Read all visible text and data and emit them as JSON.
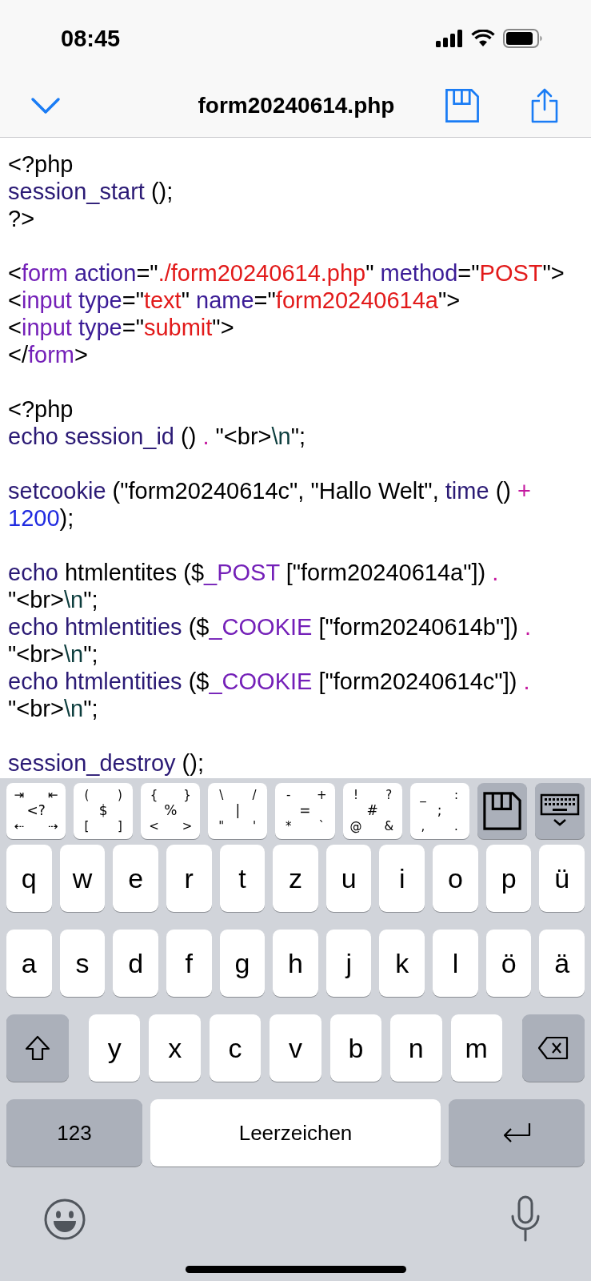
{
  "status_bar": {
    "time": "08:45"
  },
  "nav_bar": {
    "title": "form20240614.php"
  },
  "code_lines": [
    {
      "kind": "code",
      "tokens": [
        {
          "kind": "plain",
          "text": "<?php"
        }
      ]
    },
    {
      "kind": "code",
      "tokens": [
        {
          "kind": "func",
          "text": "session_start"
        },
        {
          "kind": "plain",
          "text": " ();"
        }
      ]
    },
    {
      "kind": "code",
      "tokens": [
        {
          "kind": "plain",
          "text": "?>"
        }
      ]
    },
    {
      "kind": "blank"
    },
    {
      "kind": "code",
      "tokens": [
        {
          "kind": "plain",
          "text": "<"
        },
        {
          "kind": "tag",
          "text": "form"
        },
        {
          "kind": "attr",
          "text": " action"
        },
        {
          "kind": "plain",
          "text": "=\""
        },
        {
          "kind": "string",
          "text": "./form20240614.php"
        },
        {
          "kind": "plain",
          "text": "\" "
        },
        {
          "kind": "attr",
          "text": "method"
        },
        {
          "kind": "plain",
          "text": "=\""
        },
        {
          "kind": "string",
          "text": "POST"
        },
        {
          "kind": "plain",
          "text": "\">"
        }
      ]
    },
    {
      "kind": "code",
      "tokens": [
        {
          "kind": "plain",
          "text": "<"
        },
        {
          "kind": "tag",
          "text": "input"
        },
        {
          "kind": "attr",
          "text": " type"
        },
        {
          "kind": "plain",
          "text": "=\""
        },
        {
          "kind": "string",
          "text": "text"
        },
        {
          "kind": "plain",
          "text": "\" "
        },
        {
          "kind": "attr",
          "text": "name"
        },
        {
          "kind": "plain",
          "text": "=\""
        },
        {
          "kind": "string",
          "text": "form20240614a"
        },
        {
          "kind": "plain",
          "text": "\">"
        }
      ]
    },
    {
      "kind": "code",
      "tokens": [
        {
          "kind": "plain",
          "text": "<"
        },
        {
          "kind": "tag",
          "text": "input"
        },
        {
          "kind": "attr",
          "text": " type"
        },
        {
          "kind": "plain",
          "text": "=\""
        },
        {
          "kind": "string",
          "text": "submit"
        },
        {
          "kind": "plain",
          "text": "\">"
        }
      ]
    },
    {
      "kind": "code",
      "tokens": [
        {
          "kind": "plain",
          "text": "</"
        },
        {
          "kind": "tag",
          "text": "form"
        },
        {
          "kind": "plain",
          "text": ">"
        }
      ]
    },
    {
      "kind": "blank"
    },
    {
      "kind": "code",
      "tokens": [
        {
          "kind": "plain",
          "text": "<?php"
        }
      ]
    },
    {
      "kind": "code",
      "tokens": [
        {
          "kind": "func",
          "text": "echo session_id"
        },
        {
          "kind": "plain",
          "text": " () "
        },
        {
          "kind": "op",
          "text": "."
        },
        {
          "kind": "plain",
          "text": " \"<br>"
        },
        {
          "kind": "escape",
          "text": "\\n"
        },
        {
          "kind": "plain",
          "text": "\";"
        }
      ]
    },
    {
      "kind": "blank"
    },
    {
      "kind": "code",
      "tokens": [
        {
          "kind": "func",
          "text": "setcookie"
        },
        {
          "kind": "plain",
          "text": " (\"form20240614c\", \"Hallo Welt\", "
        },
        {
          "kind": "func",
          "text": "time"
        },
        {
          "kind": "plain",
          "text": " () "
        },
        {
          "kind": "op",
          "text": "+"
        }
      ]
    },
    {
      "kind": "code",
      "tokens": [
        {
          "kind": "number",
          "text": "1200"
        },
        {
          "kind": "plain",
          "text": ");"
        }
      ]
    },
    {
      "kind": "blank"
    },
    {
      "kind": "code",
      "tokens": [
        {
          "kind": "func",
          "text": "echo"
        },
        {
          "kind": "plain",
          "text": " htmlentites ($"
        },
        {
          "kind": "tag",
          "text": "_POST"
        },
        {
          "kind": "plain",
          "text": " [\"form20240614a\"]) "
        },
        {
          "kind": "op",
          "text": "."
        }
      ]
    },
    {
      "kind": "code",
      "tokens": [
        {
          "kind": "plain",
          "text": "\"<br>"
        },
        {
          "kind": "escape",
          "text": "\\n"
        },
        {
          "kind": "plain",
          "text": "\";"
        }
      ]
    },
    {
      "kind": "code",
      "tokens": [
        {
          "kind": "func",
          "text": "echo htmlentities"
        },
        {
          "kind": "plain",
          "text": " ($"
        },
        {
          "kind": "tag",
          "text": "_COOKIE"
        },
        {
          "kind": "plain",
          "text": " [\"form20240614b\"]) "
        },
        {
          "kind": "op",
          "text": "."
        }
      ]
    },
    {
      "kind": "code",
      "tokens": [
        {
          "kind": "plain",
          "text": "\"<br>"
        },
        {
          "kind": "escape",
          "text": "\\n"
        },
        {
          "kind": "plain",
          "text": "\";"
        }
      ]
    },
    {
      "kind": "code",
      "tokens": [
        {
          "kind": "func",
          "text": "echo htmlentities"
        },
        {
          "kind": "plain",
          "text": " ($"
        },
        {
          "kind": "tag",
          "text": "_COOKIE"
        },
        {
          "kind": "plain",
          "text": " [\"form20240614c\"]) "
        },
        {
          "kind": "op",
          "text": "."
        }
      ]
    },
    {
      "kind": "code",
      "tokens": [
        {
          "kind": "plain",
          "text": "\"<br>"
        },
        {
          "kind": "escape",
          "text": "\\n"
        },
        {
          "kind": "plain",
          "text": "\";"
        }
      ]
    },
    {
      "kind": "blank"
    },
    {
      "kind": "code",
      "tokens": [
        {
          "kind": "func",
          "text": "session_destroy"
        },
        {
          "kind": "plain",
          "text": " ();"
        }
      ]
    }
  ],
  "accessory_keys": [
    {
      "kind": "symbols",
      "chars": [
        "⇥",
        "⇤",
        "<?",
        "⇠",
        "⇢"
      ]
    },
    {
      "kind": "symbols",
      "chars": [
        "(",
        ")",
        "$",
        "[",
        "]"
      ]
    },
    {
      "kind": "symbols",
      "chars": [
        "{",
        "}",
        "%",
        "<",
        ">"
      ]
    },
    {
      "kind": "symbols",
      "chars": [
        "\\",
        "/",
        "|",
        "\"",
        "'"
      ]
    },
    {
      "kind": "symbols",
      "chars": [
        "-",
        "+",
        "=",
        "*",
        "`"
      ]
    },
    {
      "kind": "symbols",
      "chars": [
        "!",
        "?",
        "#",
        "@",
        "&"
      ]
    },
    {
      "kind": "symbols",
      "chars": [
        "_",
        ":",
        ";",
        ",",
        "."
      ]
    },
    {
      "kind": "save"
    },
    {
      "kind": "hide_keyboard"
    }
  ],
  "keyboard_rows": [
    [
      {
        "kind": "letter",
        "label": "q"
      },
      {
        "kind": "letter",
        "label": "w"
      },
      {
        "kind": "letter",
        "label": "e"
      },
      {
        "kind": "letter",
        "label": "r"
      },
      {
        "kind": "letter",
        "label": "t"
      },
      {
        "kind": "letter",
        "label": "z"
      },
      {
        "kind": "letter",
        "label": "u"
      },
      {
        "kind": "letter",
        "label": "i"
      },
      {
        "kind": "letter",
        "label": "o"
      },
      {
        "kind": "letter",
        "label": "p"
      },
      {
        "kind": "letter",
        "label": "ü"
      }
    ],
    [
      {
        "kind": "letter",
        "label": "a"
      },
      {
        "kind": "letter",
        "label": "s"
      },
      {
        "kind": "letter",
        "label": "d"
      },
      {
        "kind": "letter",
        "label": "f"
      },
      {
        "kind": "letter",
        "label": "g"
      },
      {
        "kind": "letter",
        "label": "h"
      },
      {
        "kind": "letter",
        "label": "j"
      },
      {
        "kind": "letter",
        "label": "k"
      },
      {
        "kind": "letter",
        "label": "l"
      },
      {
        "kind": "letter",
        "label": "ö"
      },
      {
        "kind": "letter",
        "label": "ä"
      }
    ],
    [
      {
        "kind": "shift"
      },
      {
        "kind": "letter",
        "label": "y"
      },
      {
        "kind": "letter",
        "label": "x"
      },
      {
        "kind": "letter",
        "label": "c"
      },
      {
        "kind": "letter",
        "label": "v"
      },
      {
        "kind": "letter",
        "label": "b"
      },
      {
        "kind": "letter",
        "label": "n"
      },
      {
        "kind": "letter",
        "label": "m"
      },
      {
        "kind": "backspace"
      }
    ],
    [
      {
        "kind": "mode",
        "label": "123"
      },
      {
        "kind": "space",
        "label": "Leerzeichen"
      },
      {
        "kind": "return"
      }
    ]
  ]
}
